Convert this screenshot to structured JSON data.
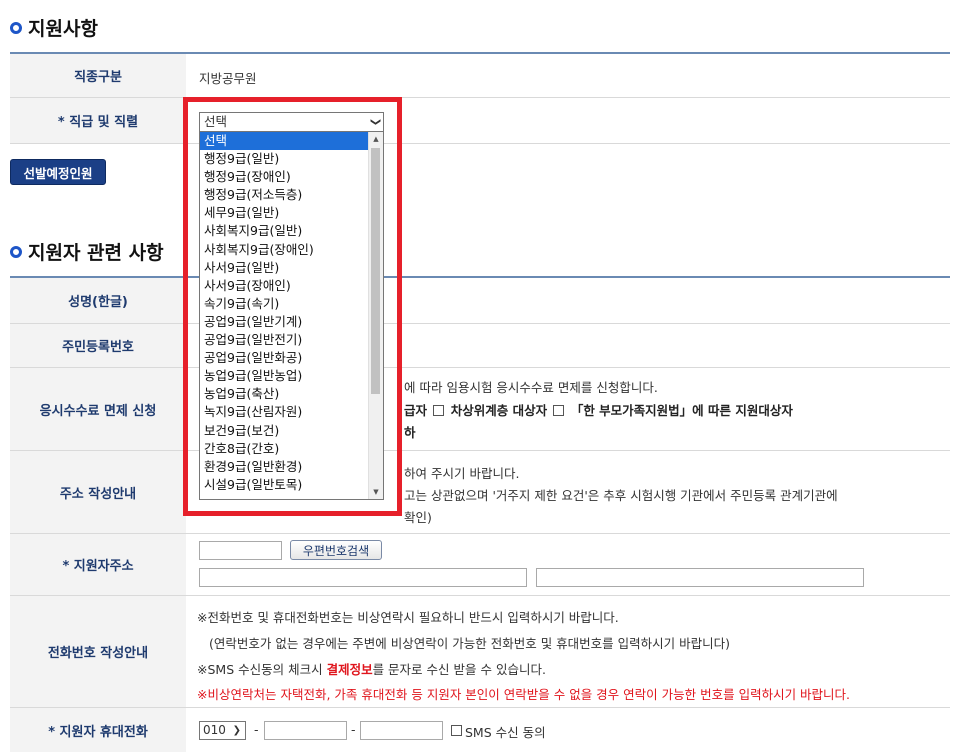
{
  "section1": {
    "title": "지원사항"
  },
  "job_category": {
    "label": "직종구분",
    "value": "지방공무원"
  },
  "grade": {
    "label": "* 직급 및 직렬",
    "selected": "선택",
    "options": [
      "선택",
      "행정9급(일반)",
      "행정9급(장애인)",
      "행정9급(저소득층)",
      "세무9급(일반)",
      "사회복지9급(일반)",
      "사회복지9급(장애인)",
      "사서9급(일반)",
      "사서9급(장애인)",
      "속기9급(속기)",
      "공업9급(일반기계)",
      "공업9급(일반전기)",
      "공업9급(일반화공)",
      "농업9급(일반농업)",
      "농업9급(축산)",
      "녹지9급(산림자원)",
      "보건9급(보건)",
      "간호8급(간호)",
      "환경9급(일반환경)",
      "시설9급(일반토목)"
    ]
  },
  "quota_button": "선발예정인원",
  "section2": {
    "title": "지원자 관련 사항"
  },
  "name_row": {
    "label": "성명(한글)"
  },
  "rrn_row": {
    "label": "주민등록번호"
  },
  "fee_row": {
    "label": "응시수수료 면제 신청",
    "line1": "에 따라 임용시험 응시수수료 면제를 신청합니다.",
    "line2a": "급자",
    "line2b": "차상위계층 대상자",
    "line2c": "「한 부모가족지원법」에 따른 지원대상자",
    "line3": "하"
  },
  "address_guide": {
    "label": "주소 작성안내",
    "line1": "하여 주시기 바랍니다.",
    "line2": "고는 상관없으며 '거주지 제한 요건'은 추후 시험시행 기관에서 주민등록 관계기관에",
    "line3": "확인)"
  },
  "address": {
    "label": "* 지원자주소",
    "zip_button": "우편번호검색"
  },
  "phone_guide": {
    "label": "전화번호 작성안내",
    "line1": "※전화번호 및 휴대전화번호는 비상연락시 필요하니 반드시 입력하시기 바랍니다.",
    "line2": "(연락번호가 없는 경우에는 주변에 비상연락이 가능한 전화번호 및 휴대번호를 입력하시기 바랍니다)",
    "line3_pre": "※SMS 수신동의 체크시 ",
    "line3_bold": "결제정보",
    "line3_post": "를 문자로 수신 받을 수 있습니다.",
    "line4": "※비상연락처는 자택전화, 가족 휴대전화 등 지원자 본인이 연락받을 수 없을 경우 연락이 가능한 번호를 입력하시기 바랍니다."
  },
  "mobile": {
    "label": "* 지원자 휴대전화",
    "prefix": "010",
    "dash": "-",
    "sms_label": "SMS 수신 동의"
  },
  "colors": {
    "highlight": "#e6202a",
    "header_text": "#1e3a6e",
    "button_bg": "#1b3f86",
    "selected_option": "#1e6fd9"
  }
}
